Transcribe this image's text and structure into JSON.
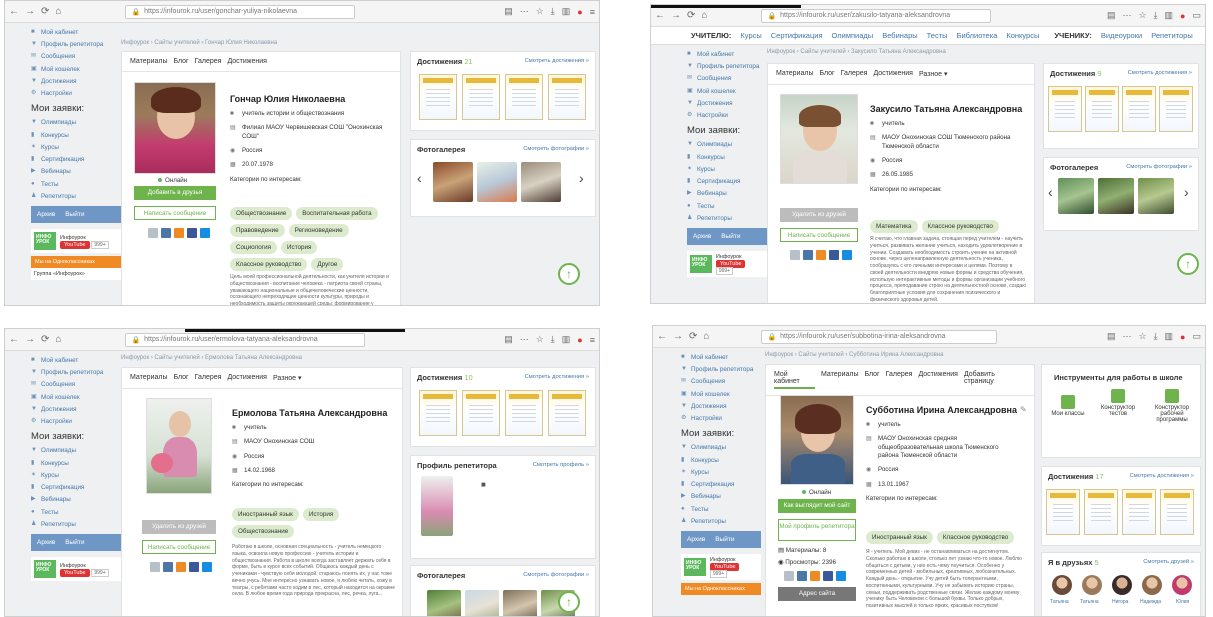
{
  "q1": {
    "url": "https://infourok.ru/user/gonchar-yuliya-nikolaevna",
    "breadcrumb": "Инфоурок › Сайты учителей › Гончар Юлия Николаевна",
    "tabs": [
      "Материалы",
      "Блог",
      "Галерея",
      "Достижения"
    ],
    "name": "Гончар Юлия Николаевна",
    "role": "учитель истории и обществознания",
    "org": "Филиал МАОУ Червишевская СОШ \"Онохинская СОШ\"",
    "country": "Россия",
    "birth": "20.07.1978",
    "status": "Онлайн",
    "add_friend": "Добавить в друзья",
    "message": "Написать сообщение",
    "interests_title": "Категории по интересам:",
    "tags": [
      "Обществознание",
      "Воспитательная работа",
      "Правоведение",
      "Регионоведение",
      "Социология",
      "История",
      "Классное руководство",
      "Другое"
    ],
    "bio": "Цель моей профессиональной деятельности, как учителя истории и обществознания - воспитание человека - патриота своей страны, уважающего национальные и общечеловеческие ценности, осознающего непреходящие ценности культуры, природы и необходимость защиты окружающей среды; формирование у учащихся картины жизни общества и человечества как в прошлом, так и в настоящем, способствовать осмыслению ими социального...",
    "achievements_title": "Достижения",
    "achievements_count": "21",
    "achievements_link": "Смотреть достижения »",
    "gallery_title": "Фотогалерея",
    "gallery_link": "Смотреть фотографии »"
  },
  "q2": {
    "url": "https://infourok.ru/user/zakusilo-tatyana-aleksandrovna",
    "topnav": {
      "teacher_label": "УЧИТЕЛЮ:",
      "teacher_items": [
        "Курсы",
        "Сертификация",
        "Олимпиады",
        "Вебинары",
        "Тесты",
        "Библиотека",
        "Конкурсы"
      ],
      "student_label": "УЧЕНИКУ:",
      "student_items": [
        "Видеоуроки",
        "Репетиторы"
      ]
    },
    "breadcrumb": "Инфоурок › Сайты учителей › Закусило Татьяна Александровна",
    "tabs": [
      "Материалы",
      "Блог",
      "Галерея",
      "Достижения",
      "Разное ▾"
    ],
    "name": "Закусило Татьяна Александровна",
    "role": "учитель",
    "org": "МАОУ Онохинская СОШ Тюменского района Тюменской области",
    "country": "Россия",
    "birth": "26.05.1985",
    "remove_friend": "Удалить из друзей",
    "message": "Написать сообщение",
    "interests_title": "Категории по интересам:",
    "tags": [
      "Математика",
      "Классное руководство"
    ],
    "bio": "Я считаю, что главная задача, стоящая перед учителем - научить учиться, развивать желание учиться, находить удовлетворение в учении. Создавать необходимость строить учение на активной основе, через целенаправленную деятельность ученика, сообразуясь с его личными интересами и целями. Поэтому в своей деятельности внедряю новые формы и средства обучения, использую интерактивные методы и формы организации учебного процесса, преподавание строю на деятельностной основе, создаю благоприятные условия для сохранения психического и физического здоровья детей.",
    "achievements_title": "Достижения",
    "achievements_count": "9",
    "achievements_link": "Смотреть достижения »",
    "gallery_title": "Фотогалерея",
    "gallery_link": "Смотреть фотографии »"
  },
  "q3": {
    "url": "https://infourok.ru/user/ermolova-tatyana-aleksandrovna",
    "breadcrumb": "Инфоурок › Сайты учителей › Ермолова Татьяна Александровна",
    "tabs": [
      "Материалы",
      "Блог",
      "Галерея",
      "Достижения",
      "Разное ▾"
    ],
    "name": "Ермолова Татьяна Александровна",
    "role": "учитель",
    "org": "МАОУ Онохинская СОШ",
    "country": "Россия",
    "birth": "14.02.1968",
    "remove_friend": "Удалить из друзей",
    "message": "Написать сообщение",
    "interests_title": "Категории по интересам:",
    "tags": [
      "Иностранный язык",
      "История",
      "Обществознание"
    ],
    "bio": "Работаю в школе, основная специальность - учитель немецкого языка, освоила новую профессию - учитель истории и обществознания. Работа в школе всегда заставляет держать себя в форме, быть в курсе всех событий. Общаюсь каждый день с учениками - чувствую себя молодой, стараюсь понять их, у нас тоже вечно учусь. Мне интересно узнавать новое, я люблю читать, хожу в театры, с ребятами часто ходим в лес, который находится на окраине села. В любое время года природа прекрасна, лес, речка, луга...",
    "achievements_title": "Достижения",
    "achievements_count": "10",
    "achievements_link": "Смотреть достижения »",
    "tutor_title": "Профиль репетитора",
    "tutor_link": "Смотреть профиль »",
    "gallery_title": "Фотогалерея",
    "gallery_link": "Смотреть фотографии »"
  },
  "q4": {
    "url": "https://infourok.ru/user/subbotina-irina-aleksandrovna",
    "breadcrumb": "Инфоурок › Сайты учителей › Субботина Ирина Александровна",
    "tabs": [
      "Мой кабинет",
      "Материалы",
      "Блог",
      "Галерея",
      "Достижения",
      "Добавить страницу"
    ],
    "name": "Субботина Ирина Александровна",
    "role": "учитель",
    "org": "МАОУ Онохинская средняя общеобразовательная школа Тюменского района Тюменской области",
    "country": "Россия",
    "birth": "13.01.1967",
    "status": "Онлайн",
    "how_looks": "Как выглядит мой сайт",
    "tutor_btn": "Мой профиль репетитора",
    "materials": "Материалы: 8",
    "views": "Просмотры: 2396",
    "site_address": "Адрес сайта",
    "interests_title": "Категории по интересам:",
    "tags": [
      "Иностранный язык",
      "Классное руководство"
    ],
    "bio": "Я - учитель. Мой девиз - не останавливаться на достигнутом. Сколько работаю в школе, столько лет узнаю что-то новое. Люблю общаться с детьми, у них есть чему поучиться. Особенно у современных детей - мобильных, креативных, любознательных. Каждый день - открытие. Учу детей быть толерантными, воспитанными, культурными. Учу не забывать историю страны, семьи, поддерживать родственные связи. Желаю каждому моему ученику быть Человеком с большой буквы. Только добрых, позитивных мыслей и только ярких, красивых поступков!",
    "tools_title": "Инструменты для работы в школе",
    "tools": [
      "Мои классы",
      "Конструктор тестов",
      "Конструктор рабочей программы"
    ],
    "achievements_title": "Достижения",
    "achievements_count": "17",
    "achievements_link": "Смотреть достижения »",
    "friends_title": "Я в друзьях",
    "friends_count": "5",
    "friends_link": "Смотреть друзей »",
    "friends": [
      "Татьяна",
      "Татьяна",
      "Нигора",
      "Надежда",
      "Юлия"
    ]
  },
  "sidebar": {
    "items": [
      "Мой кабинет",
      "Профиль репетитора",
      "Сообщения",
      "Мой кошелек",
      "Достижения",
      "Настройки"
    ],
    "requests_title": "Мои заявки:",
    "requests": [
      "Олимпиады",
      "Конкурсы",
      "Курсы",
      "Сертификация",
      "Вебинары",
      "Тесты",
      "Репетиторы"
    ],
    "archive": "Архив",
    "exit": "Выйти",
    "infourok": "Инфоурок",
    "logo_text": "ИНФО УРОК",
    "youtube": "YouTube",
    "yt_count": "999+",
    "ok_bar": "Мы на Одноклассниках",
    "ok_group": "Группа «Инфоурок»"
  },
  "colors": {
    "accent_green": "#6fb34d",
    "link_blue": "#4477aa",
    "sidebar_exit": "#6f97c6"
  }
}
